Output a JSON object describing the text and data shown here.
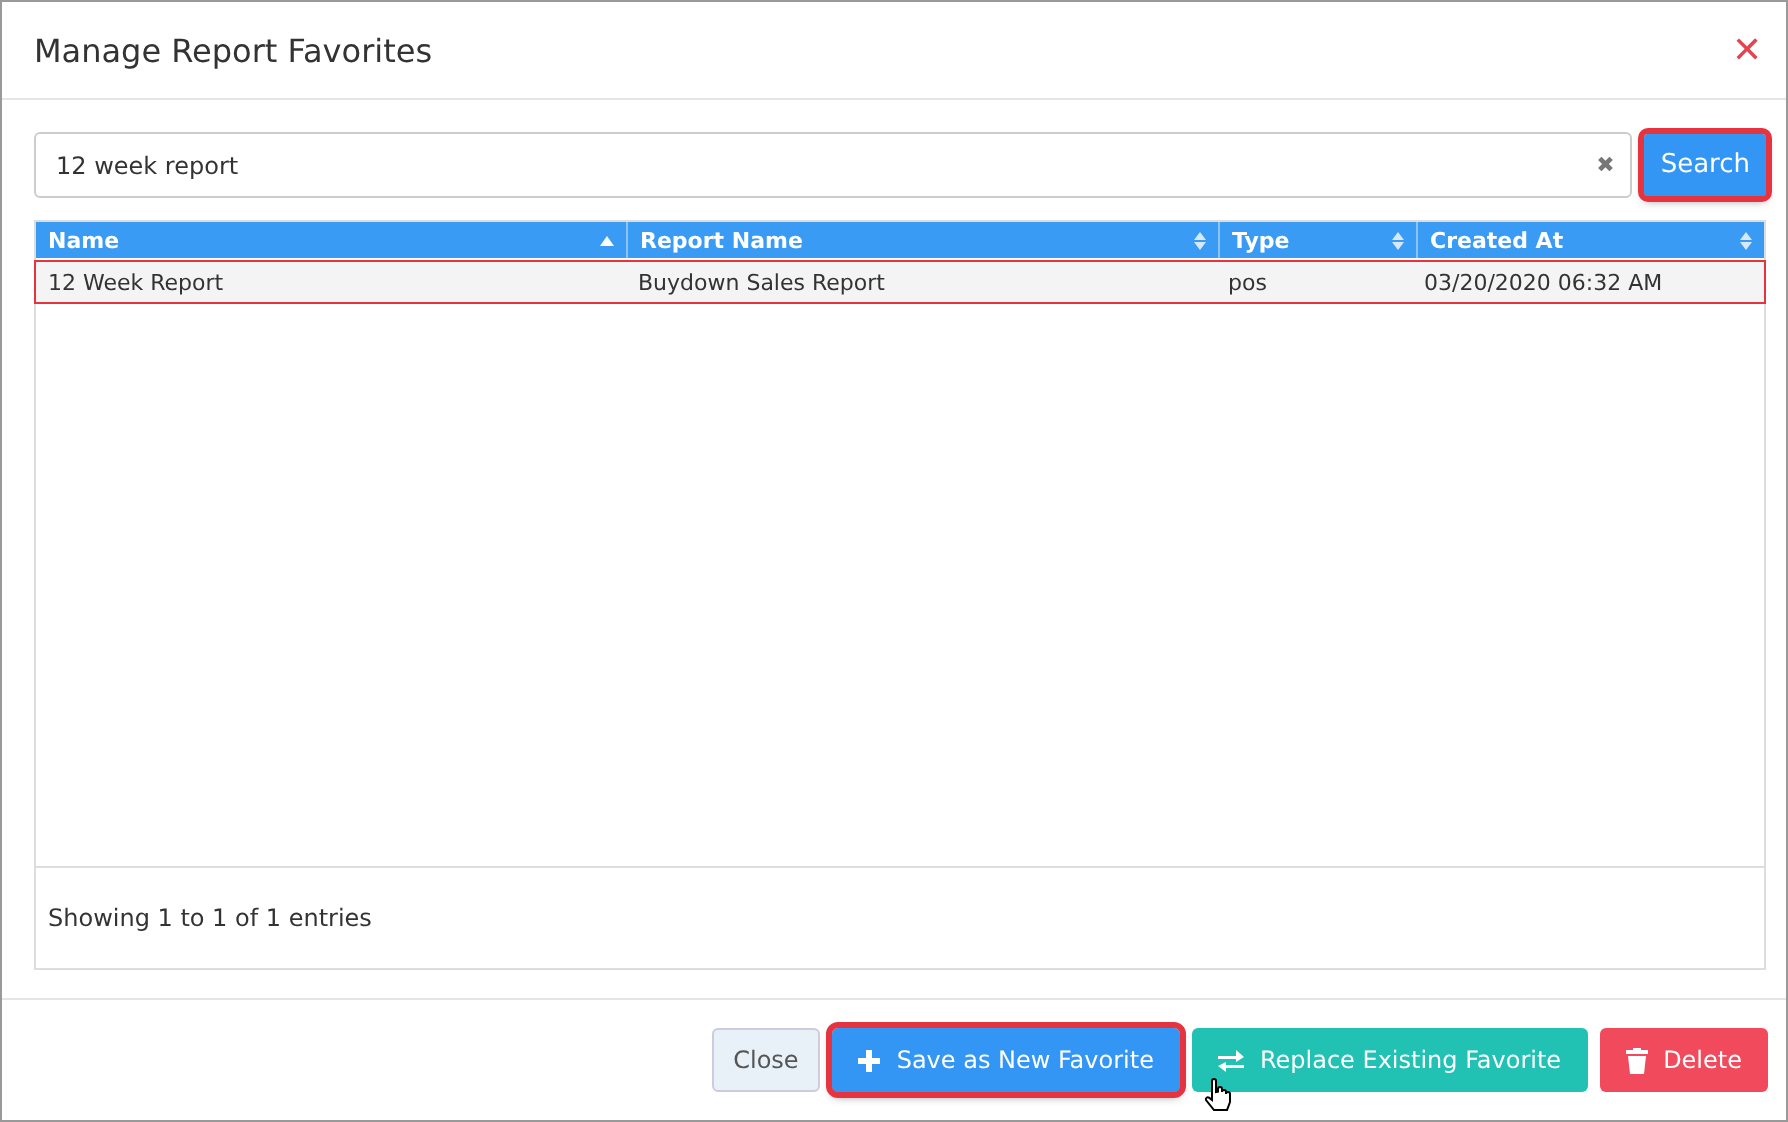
{
  "dialog": {
    "title": "Manage Report Favorites",
    "close_glyph": "✕"
  },
  "search": {
    "value": "12 week report",
    "clear_glyph": "✖",
    "button": "Search",
    "highlighted": true
  },
  "table": {
    "columns": [
      {
        "label": "Name",
        "sorted": true
      },
      {
        "label": "Report Name",
        "sorted": false
      },
      {
        "label": "Type",
        "sorted": false
      },
      {
        "label": "Created At",
        "sorted": false
      }
    ],
    "rows": [
      {
        "cells": [
          "12 Week Report",
          "Buydown Sales Report",
          "pos",
          "03/20/2020 06:32 AM"
        ],
        "highlighted": true
      }
    ],
    "info": "Showing 1 to 1 of 1 entries"
  },
  "buttons": [
    {
      "label": "Close",
      "kind": "close",
      "highlighted": false
    },
    {
      "label": "Save as New Favorite",
      "kind": "save",
      "highlighted": true
    },
    {
      "label": "Replace Existing Favorite",
      "kind": "replace",
      "highlighted": false
    },
    {
      "label": "Delete",
      "kind": "delete",
      "highlighted": false
    }
  ]
}
